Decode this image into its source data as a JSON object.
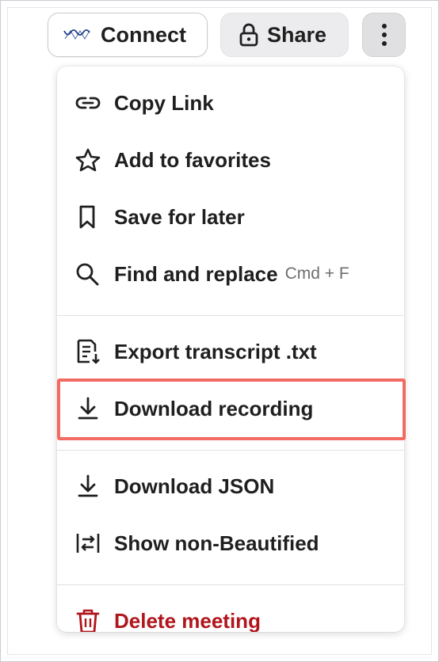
{
  "toolbar": {
    "connect_label": "Connect",
    "share_label": "Share",
    "more_icon": "vertical-ellipsis-icon"
  },
  "menu": {
    "items": [
      {
        "label": "Copy Link",
        "icon": "link-icon"
      },
      {
        "label": "Add to favorites",
        "icon": "star-icon"
      },
      {
        "label": "Save for later",
        "icon": "bookmark-icon"
      },
      {
        "label": "Find and replace",
        "icon": "search-icon",
        "shortcut": "Cmd + F"
      },
      {
        "label": "Export transcript .txt",
        "icon": "document-download-icon"
      },
      {
        "label": "Download recording",
        "icon": "download-icon",
        "highlighted": true
      },
      {
        "label": "Download JSON",
        "icon": "download-icon"
      },
      {
        "label": "Show non-Beautified",
        "icon": "swap-icon"
      },
      {
        "label": "Delete meeting",
        "icon": "trash-icon",
        "color": "#b0151c"
      }
    ]
  },
  "colors": {
    "highlight_border": "#f26a62",
    "danger": "#b0151c",
    "text": "#1f1f1f",
    "connect_icon": "#1f3e8c"
  }
}
